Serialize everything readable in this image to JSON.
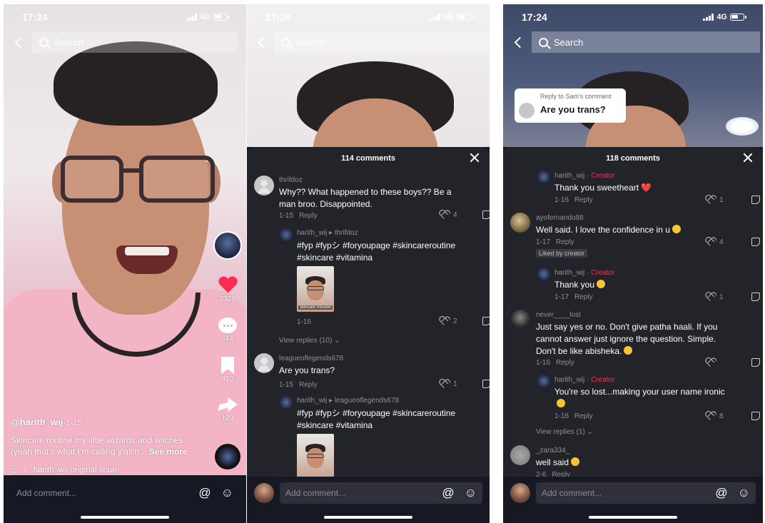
{
  "status": {
    "time": "17:24",
    "network": "4G"
  },
  "search": {
    "placeholder": "Search"
  },
  "video": {
    "username": "@harith_wij",
    "date": "1-15",
    "caption": "Skincare routine my little wizards and witches (yeah that's what I'm calling y'all n...",
    "see_more": "See more",
    "music": "‎:l - harith_wij    original soun",
    "likes": "2328",
    "comments": "114",
    "saves": "810",
    "shares": "129"
  },
  "bottom": {
    "placeholder": "Add comment..."
  },
  "panel2": {
    "header": "114 comments",
    "c1": {
      "user": "thrifdoz",
      "text": "Why?? What happened to these boys?? Be a man broo. Disappointed.",
      "date": "1-15",
      "reply": "Reply",
      "likes": "4"
    },
    "r1": {
      "user": "harith_wij ▸ thrifdoz",
      "text": "#fyp #fypシ #foryoupage #skincareroutine #skincare #vitamina",
      "date": "1-16",
      "likes": "2",
      "thumb_caption": "skincare mission"
    },
    "view_replies": "View replies (10) ⌄",
    "c2": {
      "user": "leagueoflegends678",
      "text": "Are you trans?",
      "date": "1-15",
      "reply": "Reply",
      "likes": "1"
    },
    "r2": {
      "user": "harith_wij ▸ leagueoflegends678",
      "text": "#fyp #fypシ #foryoupage #skincareroutine #skincare #vitamina"
    }
  },
  "panel3": {
    "header": "118 comments",
    "popup": {
      "label": "Reply to Sam's comment",
      "question": "Are you trans?"
    },
    "c0": {
      "user": "harith_wij",
      "creator": "Creator",
      "text": "Thank you sweetheart",
      "emoji": "❤️",
      "date": "1-16",
      "reply": "Reply",
      "likes": "1"
    },
    "c1": {
      "user": "ayofernando88",
      "text": "Well said. I love the confidence in u",
      "date": "1-17",
      "reply": "Reply",
      "likes": "4",
      "liked": "Liked by creator"
    },
    "c2": {
      "user": "harith_wij",
      "creator": "Creator",
      "text": "Thank you",
      "date": "1-17",
      "reply": "Reply",
      "likes": "1"
    },
    "c3": {
      "user": "never____lost",
      "text": "Just say yes or no. Don't give patha haali. If you cannot answer just ignore the question. Simple. Don't be like abisheka.",
      "date": "1-16",
      "reply": "Reply"
    },
    "c4": {
      "user": "harith_wij",
      "creator": "Creator",
      "text": "You're so lost...making your user name ironic",
      "date": "1-16",
      "reply": "Reply",
      "likes": "8"
    },
    "view_replies": "View replies (1) ⌄",
    "c5": {
      "user": "_zara334_",
      "text": "well said",
      "date": "2-6",
      "reply": "Reply"
    }
  }
}
